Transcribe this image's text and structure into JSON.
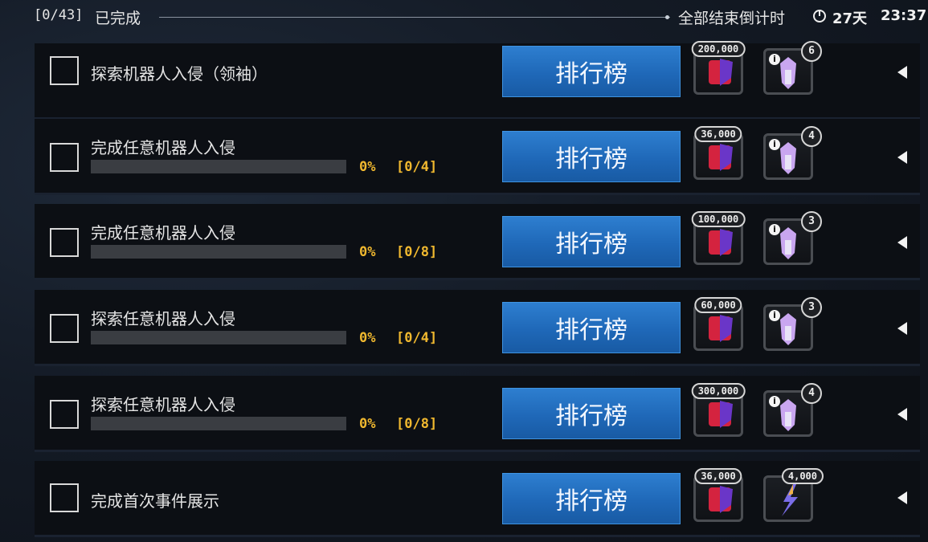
{
  "header": {
    "count": "[0/43]",
    "completed_label": "已完成",
    "end_countdown_label": "全部结束倒计时",
    "clock_icon": "clock-icon",
    "days": "27天",
    "time": "23:37"
  },
  "colors": {
    "button_blue": "#1f68b8",
    "progress_text": "#f0b82f",
    "row_bg": "#0c0f14"
  },
  "tasks": [
    {
      "title": "探索机器人入侵（领袖）",
      "rank_label": "排行榜",
      "reward1_amount": "200,000",
      "reward1_icon": "faction-crest-icon",
      "reward2_count": "6",
      "reward2_icon": "robot-part-icon",
      "reward2_info": "i"
    },
    {
      "title": "完成任意机器人入侵",
      "progress_percent": "0%",
      "progress_fraction": "[0/4]",
      "progress": 0,
      "rank_label": "排行榜",
      "reward1_amount": "36,000",
      "reward1_icon": "faction-crest-icon",
      "reward2_count": "4",
      "reward2_icon": "robot-part-icon",
      "reward2_info": "i"
    },
    {
      "title": "完成任意机器人入侵",
      "progress_percent": "0%",
      "progress_fraction": "[0/8]",
      "progress": 0,
      "rank_label": "排行榜",
      "reward1_amount": "100,000",
      "reward1_icon": "faction-crest-icon",
      "reward2_count": "3",
      "reward2_icon": "robot-part-icon",
      "reward2_info": "i"
    },
    {
      "title": "探索任意机器人入侵",
      "progress_percent": "0%",
      "progress_fraction": "[0/4]",
      "progress": 0,
      "rank_label": "排行榜",
      "reward1_amount": "60,000",
      "reward1_icon": "faction-crest-icon",
      "reward2_count": "3",
      "reward2_icon": "robot-part-icon",
      "reward2_info": "i"
    },
    {
      "title": "探索任意机器人入侵",
      "progress_percent": "0%",
      "progress_fraction": "[0/8]",
      "progress": 0,
      "rank_label": "排行榜",
      "reward1_amount": "300,000",
      "reward1_icon": "faction-crest-icon",
      "reward2_count": "4",
      "reward2_icon": "robot-part-icon",
      "reward2_info": "i"
    },
    {
      "title": "完成首次事件展示",
      "rank_label": "排行榜",
      "reward1_amount": "36,000",
      "reward1_icon": "faction-crest-icon",
      "reward2_count": "4,000",
      "reward2_icon": "energon-crystal-icon"
    }
  ]
}
